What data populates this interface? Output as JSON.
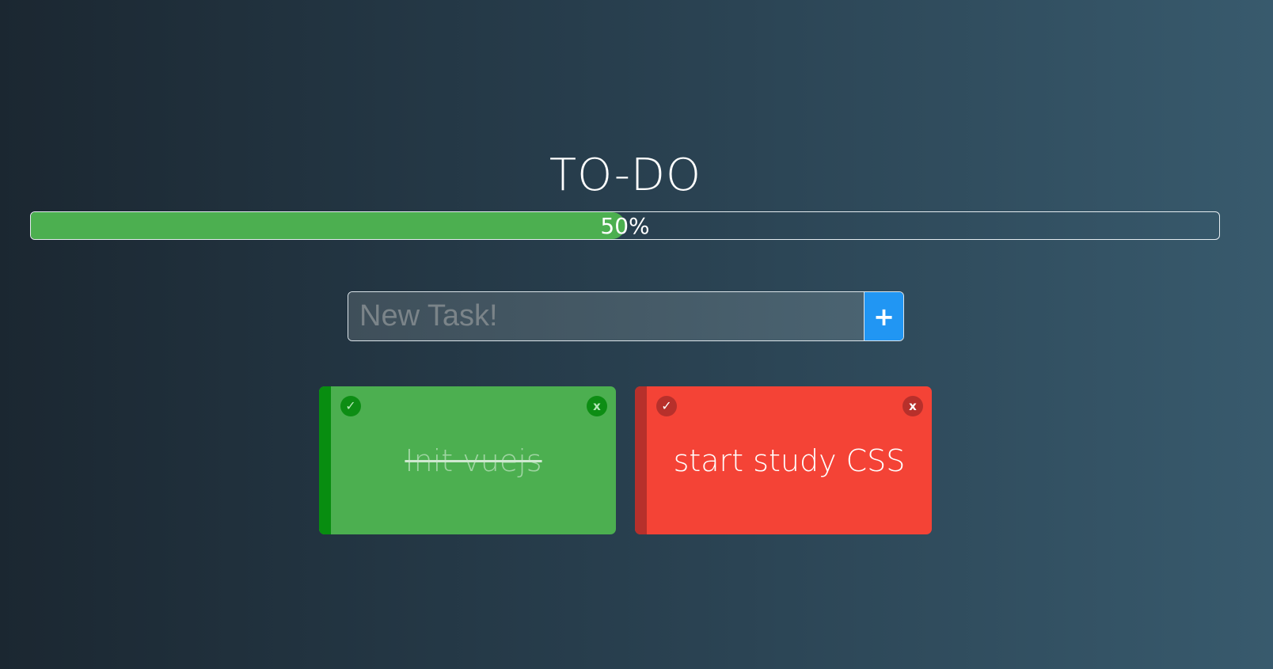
{
  "app": {
    "title": "TO-DO"
  },
  "progress": {
    "percent": 50,
    "label": "50%",
    "fill_color": "#4caf50"
  },
  "new_task": {
    "value": "",
    "placeholder": "New Task!",
    "add_label": "+",
    "add_color": "#2196f3"
  },
  "tasks": [
    {
      "text": "Init vuejs",
      "done": true,
      "check_icon": "✓",
      "delete_icon": "x",
      "color": "#4caf50"
    },
    {
      "text": "start study CSS",
      "done": false,
      "check_icon": "✓",
      "delete_icon": "x",
      "color": "#f44336"
    }
  ]
}
